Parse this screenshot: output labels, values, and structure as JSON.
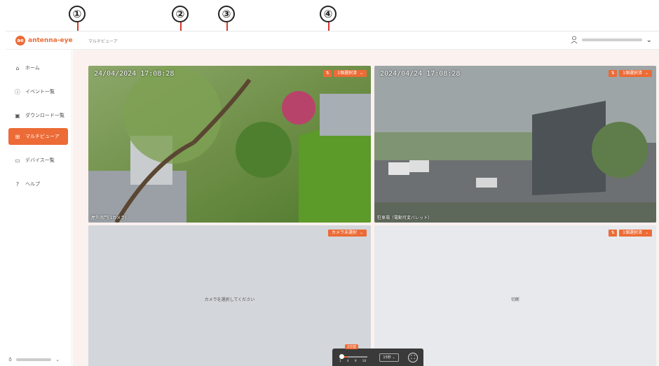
{
  "callouts": [
    "①",
    "②",
    "③",
    "④"
  ],
  "header": {
    "logo_mark": "ae",
    "logo_text": "antenna-eye",
    "breadcrumb": "マルチビューア",
    "user_menu_chevron": "chevron-down-icon"
  },
  "sidebar": {
    "items": [
      {
        "label": "ホーム",
        "icon": "home-icon"
      },
      {
        "label": "イベント一覧",
        "icon": "info-icon"
      },
      {
        "label": "ダウンロード一覧",
        "icon": "image-icon"
      },
      {
        "label": "マルチビューア",
        "icon": "grid-icon"
      },
      {
        "label": "デバイス一覧",
        "icon": "camera-icon"
      },
      {
        "label": "ヘルプ",
        "icon": "help-icon"
      }
    ],
    "active_index": 3
  },
  "tiles": [
    {
      "timestamp": "24/04/2024 17:08:28",
      "camera_name": "屋外南門(1カメラ)",
      "select_label": "1個選択済",
      "empty_text": ""
    },
    {
      "timestamp": "2024/04/24 17:08:28",
      "camera_name": "駐車場（電動可変バレット）",
      "select_label": "1個選択済",
      "empty_text": ""
    },
    {
      "timestamp": "",
      "camera_name": "",
      "select_label": "カメラ未選択",
      "empty_text": "カメラを選択してください"
    },
    {
      "timestamp": "",
      "camera_name": "",
      "select_label": "1個選択済",
      "empty_text": "切断"
    }
  ],
  "swap_label": "⇅",
  "bottom_bar": {
    "zoom_badge": "2分割",
    "ticks": [
      "1",
      "4",
      "9",
      "16"
    ],
    "interval": "15秒 ⌄",
    "fullscreen": "⛶"
  },
  "colors": {
    "accent": "#ec6b36",
    "leader": "#d63a2c"
  }
}
